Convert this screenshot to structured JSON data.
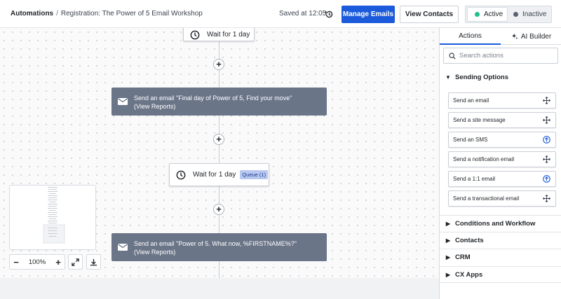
{
  "header": {
    "breadcrumb_root": "Automations",
    "breadcrumb_sep": "/",
    "breadcrumb_page": "Registration: The Power of 5 Email Workshop",
    "saved": "Saved at 12:05",
    "manage_emails": "Manage Emails",
    "view_contacts": "View Contacts",
    "status_active": "Active",
    "status_inactive": "Inactive",
    "active_color": "#1fbf8f",
    "inactive_color": "#5b6270"
  },
  "canvas": {
    "wait_top": "Wait for 1 day",
    "email_1": "Send an email \"Final day of Power of 5, Find your move\" (View Reports)",
    "wait_mid": "Wait for 1 day",
    "queue_badge": "Queue (1)",
    "email_2": "Send an email \"Power of 5. What now, %FIRSTNAME%?\" (View Reports)",
    "plus": "+"
  },
  "zoom": {
    "minus": "−",
    "level": "100%",
    "plus": "+"
  },
  "panel": {
    "tab_actions": "Actions",
    "tab_ai_builder": "AI Builder",
    "search_placeholder": "Search actions",
    "sending_options": "Sending Options",
    "actions": [
      {
        "label": "Send an email",
        "icon": "move-icon"
      },
      {
        "label": "Send a site message",
        "icon": "move-icon"
      },
      {
        "label": "Send an SMS",
        "icon": "upgrade-icon"
      },
      {
        "label": "Send a notification email",
        "icon": "move-icon"
      },
      {
        "label": "Send a 1:1 email",
        "icon": "upgrade-icon"
      },
      {
        "label": "Send a transactional email",
        "icon": "move-icon"
      }
    ],
    "sections": [
      "Conditions and Workflow",
      "Contacts",
      "CRM",
      "CX Apps"
    ]
  }
}
